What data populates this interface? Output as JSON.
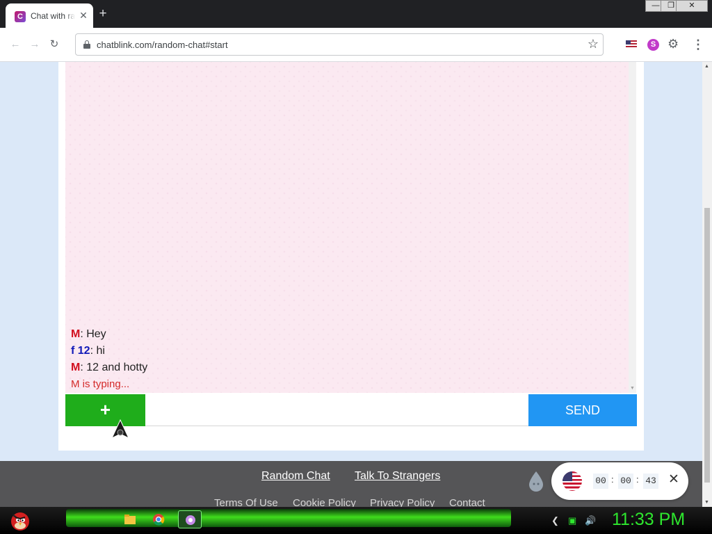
{
  "browser": {
    "tab_title": "Chat with ra",
    "tab_favicon_letter": "C",
    "new_tab": "+",
    "tab_close": "✕",
    "url": "chatblink.com/random-chat#start",
    "window_controls": {
      "minimize": "—",
      "restore": "❐",
      "close": "✕"
    },
    "extension_s_letter": "S"
  },
  "chat": {
    "messages": [
      {
        "nick": "M",
        "text": ": Hey",
        "nick_color": "#d10f1f"
      },
      {
        "nick": "f 12",
        "text": ": hi",
        "nick_color": "#1019b8"
      },
      {
        "nick": "M",
        "text": ": 12 and hotty",
        "nick_color": "#d10f1f"
      }
    ],
    "typing_status": "M is typing..."
  },
  "composer": {
    "plus_label": "+",
    "input_value": "",
    "send_label": "SEND"
  },
  "footer": {
    "links": [
      "Random Chat",
      "Talk To Strangers"
    ],
    "secondary_links": [
      "Terms Of Use",
      "Cookie Policy",
      "Privacy Policy",
      "Contact"
    ]
  },
  "timer": {
    "hours": "00",
    "minutes": "00",
    "seconds": "43",
    "separator": ":",
    "close": "✕"
  },
  "taskbar": {
    "clock": "11:33 PM"
  },
  "colors": {
    "accent_green": "#1fad1b",
    "send_blue": "#2196f3",
    "chat_background": "#fbe9f1",
    "page_background": "#dbe8f8",
    "footer_background": "#555557",
    "clock_green": "#2ee62e"
  },
  "icons": [
    "favicon-icon",
    "lock-icon",
    "star-icon",
    "us-flag-icon",
    "puzzle-icon",
    "menu-dots-icon",
    "drop-icon",
    "close-icon",
    "angry-bird-start-icon",
    "folder-icon",
    "chrome-icon",
    "app-icon"
  ]
}
